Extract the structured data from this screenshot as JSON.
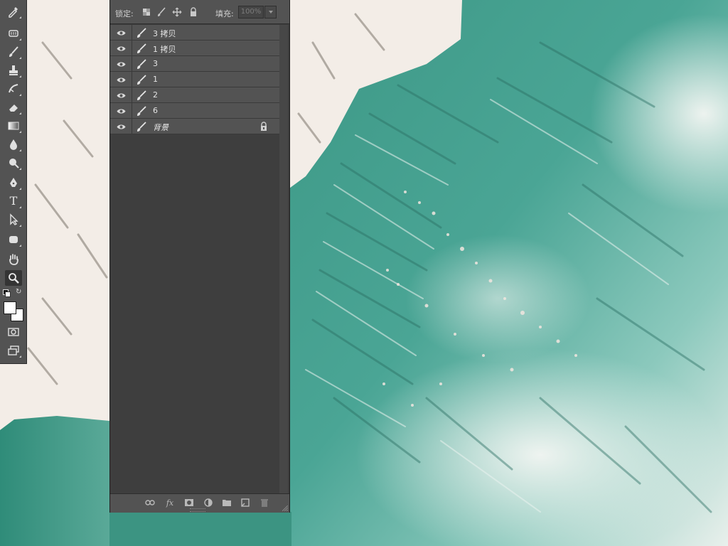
{
  "colors": {
    "panel_bg": "#3e3e3e",
    "bar_bg": "#535353",
    "toolbar_bg": "#535353",
    "foreground_color": "#ffffff",
    "background_color": "#ffffff",
    "canvas_teal": "#3f9a8a",
    "canvas_cream": "#f3ede7"
  },
  "toolbar": {
    "tools": [
      {
        "name": "eyedropper-icon"
      },
      {
        "name": "healing-brush-icon"
      },
      {
        "name": "brush-icon"
      },
      {
        "name": "clone-stamp-icon"
      },
      {
        "name": "history-brush-icon"
      },
      {
        "name": "eraser-icon"
      },
      {
        "name": "gradient-icon"
      },
      {
        "name": "blur-icon"
      },
      {
        "name": "dodge-icon"
      },
      {
        "name": "pen-icon"
      },
      {
        "name": "type-icon",
        "glyph": "T"
      },
      {
        "name": "path-selection-icon"
      },
      {
        "name": "shape-icon"
      },
      {
        "name": "hand-icon"
      },
      {
        "name": "zoom-icon",
        "active": true
      },
      {
        "name": "quick-mask-icon"
      },
      {
        "name": "screen-mode-icon"
      }
    ]
  },
  "layers_panel": {
    "lock_label": "锁定:",
    "fill_label": "填充:",
    "fill_value": "100%",
    "lock_icons": [
      "lock-transparent-icon",
      "lock-image-icon",
      "lock-position-icon",
      "lock-all-icon"
    ],
    "layers": [
      {
        "name": "3 拷贝",
        "visible": true,
        "locked": false
      },
      {
        "name": "1 拷贝",
        "visible": true,
        "locked": false
      },
      {
        "name": "3",
        "visible": true,
        "locked": false
      },
      {
        "name": "1",
        "visible": true,
        "locked": false
      },
      {
        "name": "2",
        "visible": true,
        "locked": false
      },
      {
        "name": "6",
        "visible": true,
        "locked": false
      },
      {
        "name": "背景",
        "visible": true,
        "locked": true
      }
    ],
    "bottom_icons": [
      "link-icon",
      "fx-icon",
      "mask-icon",
      "adjustment-icon",
      "folder-icon",
      "new-layer-icon",
      "trash-icon"
    ]
  }
}
